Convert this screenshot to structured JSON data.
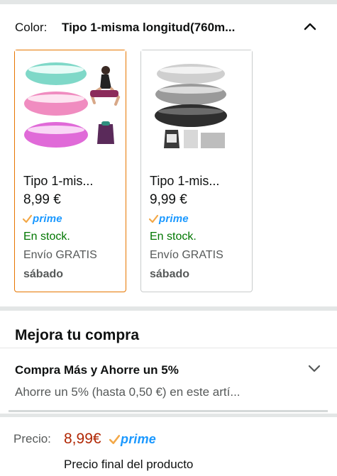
{
  "variation": {
    "label": "Color:",
    "selected_value": "Tipo 1-misma longitud(760m..."
  },
  "cards": [
    {
      "title": "Tipo 1-mis...",
      "price": "8,99 €",
      "prime": "prime",
      "stock": "En stock.",
      "shipping": "Envío GRATIS",
      "delivery_day": "sábado",
      "selected": true,
      "colors": [
        "#7fd8c8",
        "#f08cc0",
        "#e06ad8"
      ]
    },
    {
      "title": "Tipo 1-mis...",
      "price": "9,99 €",
      "prime": "prime",
      "stock": "En stock.",
      "shipping": "Envío GRATIS",
      "delivery_day": "sábado",
      "selected": false,
      "colors": [
        "#c8c8c8",
        "#9a9a9a",
        "#2e2e2e"
      ]
    }
  ],
  "upgrade": {
    "title": "Mejora tu compra",
    "promo_title": "Compra Más y Ahorre un 5%",
    "promo_desc": "Ahorre un 5% (hasta 0,50 €) en este artí..."
  },
  "price": {
    "label": "Precio:",
    "value": "8,99€",
    "prime": "prime",
    "note": "Precio final del producto"
  },
  "colors": {
    "accent_selected_border": "#e77600",
    "price_red": "#b12704",
    "stock_green": "#007600",
    "prime_blue": "#1a98ff",
    "prime_check": "#f3a847"
  },
  "icons": {
    "collapse": "chevron-up-icon",
    "expand": "chevron-down-icon",
    "prime": "prime-check-icon"
  }
}
